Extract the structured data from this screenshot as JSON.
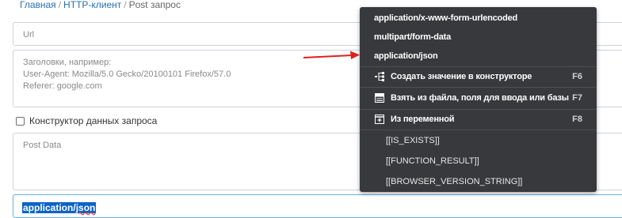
{
  "breadcrumb": {
    "home": "Главная",
    "sep1": "/",
    "section": "HTTP-клиент",
    "sep2": "/",
    "current": "Post запрос"
  },
  "url_field": {
    "placeholder": "Url"
  },
  "headers_field": {
    "placeholder_lines": [
      "Заголовки, например:",
      "User-Agent: Mozilla/5.0 Gecko/20100101 Firefox/57.0",
      "Referer: google.com"
    ]
  },
  "constructor_checkbox": {
    "label": "Конструктор данных запроса",
    "checked": false
  },
  "post_data_field": {
    "placeholder": "Post Data"
  },
  "content_type_field": {
    "value_part1": "application/",
    "value_part2": "json"
  },
  "dropdown": {
    "content_types": [
      "application/x-www-form-urlencoded",
      "multipart/form-data",
      "application/json"
    ],
    "actions": [
      {
        "label": "Создать значение в конструкторе",
        "shortcut": "F6",
        "icon": "tree-structure-icon"
      },
      {
        "label": "Взять из файла, поля для ввода или базы",
        "shortcut": "F7",
        "icon": "file-data-icon"
      },
      {
        "label": "Из переменной",
        "shortcut": "F8",
        "icon": "variable-box-icon"
      }
    ],
    "variables": [
      "[[IS_EXISTS]]",
      "[[FUNCTION_RESULT]]",
      "[[BROWSER_VERSION_STRING]]"
    ]
  },
  "colors": {
    "dropdown_bg": "#37393c",
    "link": "#2a6fb0",
    "selection": "#0b63c9",
    "arrow": "#e02020"
  }
}
